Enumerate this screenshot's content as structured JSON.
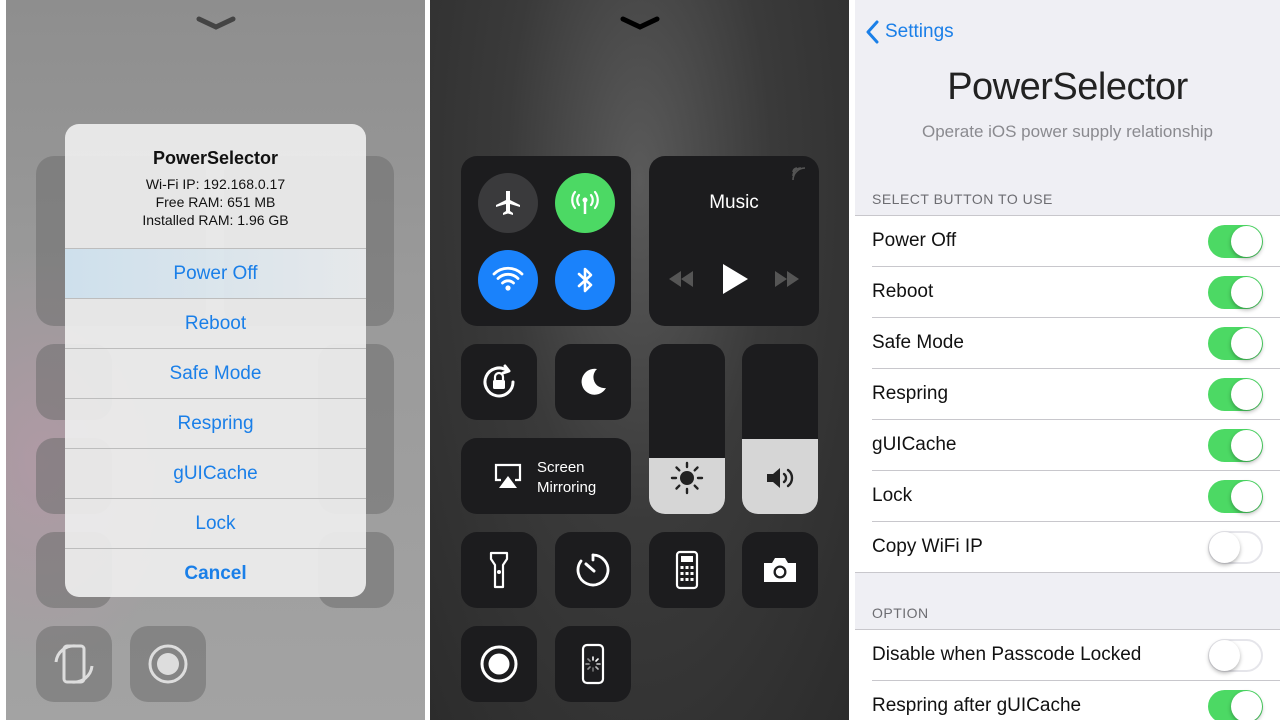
{
  "panel1": {
    "alert": {
      "title": "PowerSelector",
      "wifi_ip": "Wi-Fi IP: 192.168.0.17",
      "free_ram": "Free RAM: 651 MB",
      "installed_ram": "Installed RAM: 1.96 GB",
      "actions": [
        "Power Off",
        "Reboot",
        "Safe Mode",
        "Respring",
        "gUICache",
        "Lock"
      ],
      "cancel": "Cancel"
    }
  },
  "panel2": {
    "music": {
      "title": "Music"
    },
    "screen_mirroring": {
      "line1": "Screen",
      "line2": "Mirroring"
    },
    "brightness_level": 0.33,
    "volume_level": 0.44,
    "colors": {
      "airplane_off": "#3a3a3c",
      "cellular_on": "#4cd964",
      "wifi_on": "#1a82fb",
      "bluetooth_on": "#1a82fb"
    }
  },
  "panel3": {
    "back_label": "Settings",
    "title": "PowerSelector",
    "subtitle": "Operate iOS power supply relationship",
    "section1": {
      "header": "SELECT BUTTON TO USE",
      "rows": [
        {
          "label": "Power Off",
          "on": true
        },
        {
          "label": "Reboot",
          "on": true
        },
        {
          "label": "Safe Mode",
          "on": true
        },
        {
          "label": "Respring",
          "on": true
        },
        {
          "label": "gUICache",
          "on": true
        },
        {
          "label": "Lock",
          "on": true
        },
        {
          "label": "Copy WiFi IP",
          "on": false
        }
      ]
    },
    "section2": {
      "header": "OPTION",
      "rows": [
        {
          "label": "Disable when Passcode Locked",
          "on": false
        },
        {
          "label": "Respring after gUICache",
          "on": true
        }
      ]
    },
    "colors": {
      "accent": "#1a7fe8",
      "toggle_on": "#4cd964"
    }
  }
}
